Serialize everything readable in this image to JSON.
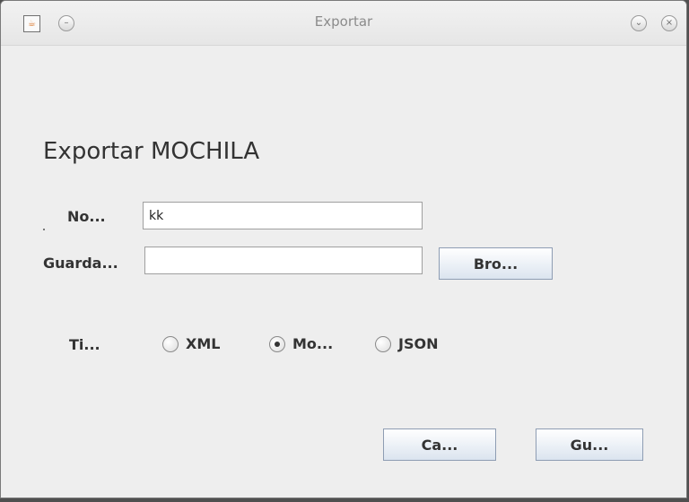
{
  "window": {
    "title": "Exportar"
  },
  "heading": "Exportar MOCHILA",
  "form": {
    "name_label": "No...",
    "name_value": "kk",
    "save_label": "Guarda...",
    "save_value": "",
    "browse_label": "Bro...",
    "type_label": "Ti...",
    "options": [
      {
        "label": "XML",
        "selected": false
      },
      {
        "label": "Mo...",
        "selected": true
      },
      {
        "label": "JSON",
        "selected": false
      }
    ]
  },
  "actions": {
    "cancel": "Ca...",
    "save": "Gu..."
  },
  "icons": {
    "app_icon": "java-icon",
    "minimize_icon": "minimize-icon",
    "restore_icon": "restore-icon",
    "close_icon": "close-icon"
  },
  "colors": {
    "window_background": "#eeeeee",
    "button_border": "#8e9db3",
    "title_text": "#8b8b8b"
  }
}
